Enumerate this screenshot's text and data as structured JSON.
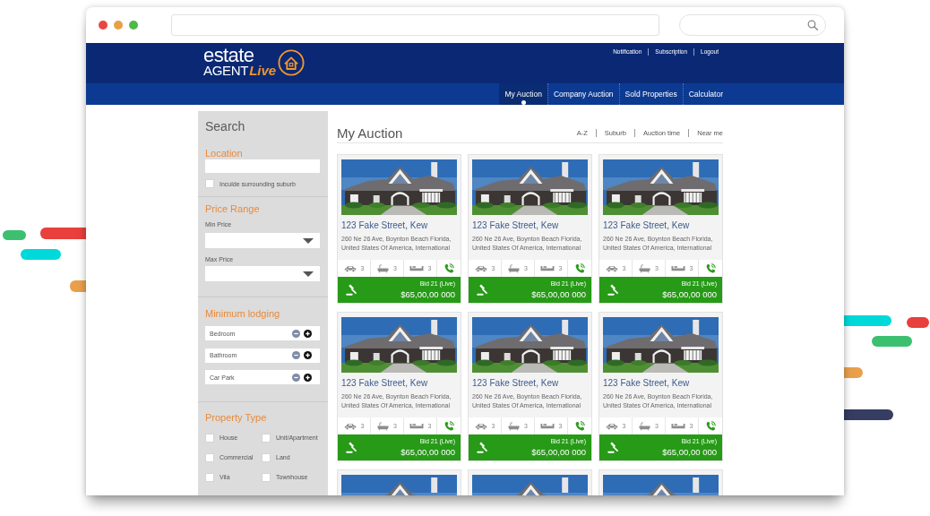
{
  "header": {
    "logo": {
      "word_1": "estate",
      "word_2": "AGENT",
      "word_3": "Live"
    },
    "links": [
      "Notification",
      "Subscription",
      "Logout"
    ]
  },
  "nav_tabs": [
    {
      "label": "My Auction",
      "selected": true
    },
    {
      "label": "Company Auction",
      "selected": false
    },
    {
      "label": "Sold Properties",
      "selected": false
    },
    {
      "label": "Calculator",
      "selected": false
    }
  ],
  "sidebar": {
    "title": "Search",
    "location": {
      "heading": "Location",
      "option": {
        "label": "Inculde surrounding suburb",
        "checked": false
      }
    },
    "price_range": {
      "heading": "Price Range",
      "fields": [
        {
          "label": "Min Price"
        },
        {
          "label": "Max Price"
        }
      ]
    },
    "minimum_lodging": {
      "heading": "Minimum lodging",
      "items": [
        {
          "label": "Bedroom"
        },
        {
          "label": "Bathroom"
        },
        {
          "label": "Car Park"
        }
      ]
    },
    "property_type": {
      "heading": "Property Type",
      "options": [
        {
          "label": "House",
          "checked": false
        },
        {
          "label": "Unit/Apartment",
          "checked": false
        },
        {
          "label": "Commercial",
          "checked": false
        },
        {
          "label": "Land",
          "checked": false
        },
        {
          "label": "Vila",
          "checked": false
        },
        {
          "label": "Townhouse",
          "checked": false
        }
      ]
    }
  },
  "main": {
    "title": "My Auction",
    "sort_links": [
      "A-Z",
      "Suburb",
      "Auction time",
      "Near me"
    ],
    "listings": [
      {
        "kind": "full",
        "title": "123 Fake Street, Kew",
        "address": "260 Ne 26 Ave, Boynton Beach Florida, United States Of America, International",
        "features": [
          {
            "kind": "car",
            "count": "3"
          },
          {
            "kind": "bath",
            "count": "3"
          },
          {
            "kind": "sofa",
            "count": "3"
          }
        ],
        "bid": "Bid 21 (Live)",
        "price": "$65,00,00 000"
      },
      {
        "kind": "full",
        "title": "123 Fake Street, Kew",
        "address": "260 Ne 26 Ave, Boynton Beach Florida, United States Of America, International",
        "features": [
          {
            "kind": "car",
            "count": "3"
          },
          {
            "kind": "bath",
            "count": "3"
          },
          {
            "kind": "sofa",
            "count": "3"
          }
        ],
        "bid": "Bid 21 (Live)",
        "price": "$65,00,00 000"
      },
      {
        "kind": "full",
        "title": "123 Fake Street, Kew",
        "address": "260 Ne 26 Ave, Boynton Beach Florida, United States Of America, International",
        "features": [
          {
            "kind": "car",
            "count": "3"
          },
          {
            "kind": "bath",
            "count": "3"
          },
          {
            "kind": "sofa",
            "count": "3"
          }
        ],
        "bid": "Bid 21 (Live)",
        "price": "$65,00,00 000"
      },
      {
        "kind": "full",
        "title": "123 Fake Street, Kew",
        "address": "260 Ne 26 Ave, Boynton Beach Florida, United States Of America, International",
        "features": [
          {
            "kind": "car",
            "count": "3"
          },
          {
            "kind": "bath",
            "count": "3"
          },
          {
            "kind": "sofa",
            "count": "3"
          }
        ],
        "bid": "Bid 21 (Live)",
        "price": "$65,00,00 000"
      },
      {
        "kind": "full",
        "title": "123 Fake Street, Kew",
        "address": "260 Ne 26 Ave, Boynton Beach Florida, United States Of America, International",
        "features": [
          {
            "kind": "car",
            "count": "3"
          },
          {
            "kind": "bath",
            "count": "3"
          },
          {
            "kind": "sofa",
            "count": "3"
          }
        ],
        "bid": "Bid 21 (Live)",
        "price": "$65,00,00 000"
      },
      {
        "kind": "full",
        "title": "123 Fake Street, Kew",
        "address": "260 Ne 26 Ave, Boynton Beach Florida, United States Of America, International",
        "features": [
          {
            "kind": "car",
            "count": "3"
          },
          {
            "kind": "bath",
            "count": "3"
          },
          {
            "kind": "sofa",
            "count": "3"
          }
        ],
        "bid": "Bid 21 (Live)",
        "price": "$65,00,00 000"
      },
      {
        "kind": "photo_only"
      },
      {
        "kind": "photo_only"
      },
      {
        "kind": "photo_only"
      }
    ]
  }
}
